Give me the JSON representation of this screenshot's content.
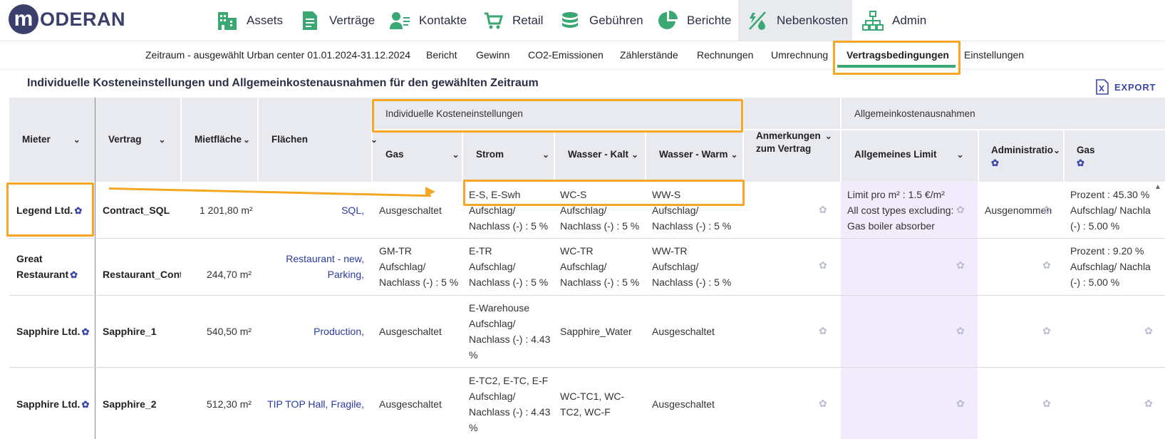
{
  "brand": {
    "logo_letter": "m",
    "logo_text": "ODERAN"
  },
  "nav": [
    {
      "label": "Assets",
      "icon": "building-icon"
    },
    {
      "label": "Verträge",
      "icon": "document-icon"
    },
    {
      "label": "Kontakte",
      "icon": "contacts-icon"
    },
    {
      "label": "Retail",
      "icon": "cart-icon"
    },
    {
      "label": "Gebühren",
      "icon": "coins-icon"
    },
    {
      "label": "Berichte",
      "icon": "pie-chart-icon"
    },
    {
      "label": "Nebenkosten",
      "icon": "utilities-icon"
    },
    {
      "label": "Admin",
      "icon": "hierarchy-icon"
    }
  ],
  "subnav": {
    "period": "Zeitraum - ausgewählt Urban center 01.01.2024-31.12.2024",
    "items": [
      "Bericht",
      "Gewinn",
      "CO2-Emissionen",
      "Zählerstände",
      "Rechnungen",
      "Umrechnung",
      "Vertragsbedingungen",
      "Einstellungen"
    ],
    "active": "Vertragsbedingungen"
  },
  "page_title": "Individuelle Kosteneinstellungen und Allgemeinkostenausnahmen für den gewählten Zeitraum",
  "export_label": "EXPORT",
  "table": {
    "headers": {
      "mieter": "Mieter",
      "vertrag": "Vertrag",
      "mietflaeche": "Mietfläche",
      "flaechen": "Flächen",
      "group_individual": "Individuelle Kosteneinstellungen",
      "gas": "Gas",
      "strom": "Strom",
      "wasser_kalt": "Wasser - Kalt",
      "wasser_warm": "Wasser - Warm",
      "anmerkungen_1": "Anmerkungen",
      "anmerkungen_2": "zum Vertrag",
      "group_general": "Allgemeinkostenausnahmen",
      "allgemeines_limit": "Allgemeines Limit",
      "administration": "Administratio",
      "gas2": "Gas"
    },
    "rows": [
      {
        "mieter": "Legend Ltd.",
        "vertrag": "Contract_SQL",
        "flaeche": "1 201,80 m²",
        "flaechen": "SQL,",
        "gas": [
          "Ausgeschaltet"
        ],
        "strom": [
          "E-S, E-Swh",
          "Aufschlag/",
          "Nachlass (-) : 5 %"
        ],
        "wasser_kalt": [
          "WC-S",
          "Aufschlag/",
          "Nachlass (-) : 5 %"
        ],
        "wasser_warm": [
          "WW-S",
          "Aufschlag/",
          "Nachlass (-) : 5 %"
        ],
        "limit": [
          "Limit pro m² : 1.5 €/m²",
          "All cost types excluding:",
          "Gas boiler absorber"
        ],
        "admin": "Ausgenommen",
        "gas2": [
          "Prozent : 45.30 %",
          "Aufschlag/ Nachla",
          "(-) : 5.00 %"
        ]
      },
      {
        "mieter_1": "Great",
        "mieter_2": "Restaurant",
        "vertrag": "Restaurant_Contr",
        "flaeche": "244,70 m²",
        "flaechen_1": "Restaurant - new,",
        "flaechen_2": "Parking,",
        "gas": [
          "GM-TR",
          "Aufschlag/",
          "Nachlass (-) : 5 %"
        ],
        "strom": [
          "E-TR",
          "Aufschlag/",
          "Nachlass (-) : 5 %"
        ],
        "wasser_kalt": [
          "WC-TR",
          "Aufschlag/",
          "Nachlass (-) : 5 %"
        ],
        "wasser_warm": [
          "WW-TR",
          "Aufschlag/",
          "Nachlass (-) : 5 %"
        ],
        "gas2": [
          "Prozent : 9.20 %",
          "Aufschlag/ Nachla",
          "(-) : 5.00 %"
        ]
      },
      {
        "mieter": "Sapphire Ltd.",
        "vertrag": "Sapphire_1",
        "flaeche": "540,50 m²",
        "flaechen": "Production,",
        "gas": [
          "Ausgeschaltet"
        ],
        "strom": [
          "E-Warehouse",
          "Aufschlag/",
          "Nachlass (-) : 4.43",
          "%"
        ],
        "wasser_kalt": [
          "Sapphire_Water"
        ],
        "wasser_warm": [
          "Ausgeschaltet"
        ]
      },
      {
        "mieter": "Sapphire Ltd.",
        "vertrag": "Sapphire_2",
        "flaeche": "512,30 m²",
        "flaechen": "TIP TOP Hall, Fragile,",
        "gas": [
          "Ausgeschaltet"
        ],
        "strom": [
          "E-TC2, E-TC, E-F",
          "Aufschlag/",
          "Nachlass (-) : 4.43",
          "%"
        ],
        "wasser_kalt": [
          "WC-TC1, WC-",
          "TC2, WC-F"
        ],
        "wasser_warm": [
          "Ausgeschaltet"
        ]
      }
    ]
  },
  "colors": {
    "accent_green": "#3aa872",
    "highlight_orange": "#f5a623",
    "brand_navy": "#3b3f6b",
    "header_bg": "#e8eaf0",
    "purple_col": "#f1ebfb"
  }
}
